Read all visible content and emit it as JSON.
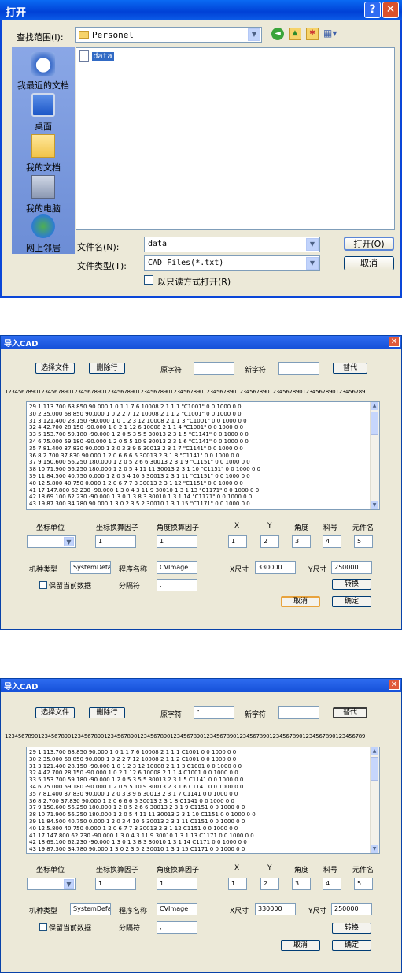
{
  "open_dialog": {
    "title": "打开",
    "look_in_label": "查找范围(I):",
    "look_in_value": "Personel",
    "files": [
      "data"
    ],
    "places": [
      "我最近的文档",
      "桌面",
      "我的文档",
      "我的电脑",
      "网上邻居"
    ],
    "filename_label": "文件名(N):",
    "filename_value": "data",
    "filetype_label": "文件类型(T):",
    "filetype_value": "CAD Files(*.txt)",
    "readonly_label": "以只读方式打开(R)",
    "open_button": "打开(O)",
    "cancel_button": "取消"
  },
  "import_dialogs": [
    {
      "title": "导入CAD",
      "select_file_button": "选择文件",
      "delete_row_button": "删除行",
      "orig_char_label": "原字符",
      "orig_char_value": "",
      "new_char_label": "新字符",
      "new_char_value": "",
      "replace_button": "替代",
      "ruler": "1234567890123456789012345678901234567890123456789012345678901234567890123456789012345678901234567890123456789",
      "rows": [
        "29 1 113.700 68.850 90.000 1 0 1 1 7 6 10008 2 1 1 1 \"C1001\" 0 0 1000 0 0",
        "30 2 35.000 68.850 90.000 1 0 2 2 7 12 10008 2 1 1 2 \"C1001\" 0 0 1000 0 0",
        "31 3 121.400 28.150 -90.000 1 0 1 2 3 12 10008 2 1 1 3 \"C1001\" 0 0 1000 0 0",
        "32 4 42.700 28.150 -90.000 1 0 2 1 12 6 10008 2 1 1 4 \"C1001\" 0 0 1000 0 0",
        "33 5 153.700 59.180 -90.000 1 2 0 5 3 5 5 30013 2 3 1 5 \"C1141\" 0 0 1000 0 0",
        "34 6 75.000 59.180 -90.000 1 2 0 5 5 10 9 30013 2 3 1 6 \"C1141\" 0 0 1000 0 0",
        "35 7 81.400 37.830 90.000 1 2 0 3 3 9 6 30013 2 3 1 7 \"C1141\" 0 0 1000 0 0",
        "36 8 2.700 37.830 90.000 1 2 0 6 6 6 5 30013 2 3 1 8 \"C1141\" 0 0 1000 0 0",
        "37 9 150.600 56.250 180.000 1 2 0 5 2 6 6 30013 2 3 1 9 \"C1151\" 0 0 1000 0 0",
        "38 10 71.900 56.250 180.000 1 2 0 5 4 11 11 30013 2 3 1 10 \"C1151\" 0 0 1000 0 0",
        "39 11 84.500 40.750 0.000 1 2 0 3 4 10 5 30013 2 3 1 11 \"C1151\" 0 0 1000 0 0",
        "40 12 5.800 40.750 0.000 1 2 0 6 7 7 3 30013 2 3 1 12 \"C1151\" 0 0 1000 0 0",
        "41 17 147.800 62.230 -90.000 1 3 0 4 3 11 9 30010 1 3 1 13 \"C1171\" 0 0 1000 0 0",
        "42 18 69.100 62.230 -90.000 1 3 0 1 3 8 3 30010 1 3 1 14 \"C1171\" 0 0 1000 0 0",
        "43 19 87.300 34.780 90.000 1 3 0 2 3 5 2 30010 1 3 1 15 \"C1171\" 0 0 1000 0 0"
      ],
      "coord_unit_label": "坐标单位",
      "coord_unit_value": "",
      "coord_scale_label": "坐标换算因子",
      "coord_scale_value": "1",
      "angle_scale_label": "角度换算因子",
      "angle_scale_value": "1",
      "x_label": "X",
      "x_value": "1",
      "y_label": "Y",
      "y_value": "2",
      "angle_label": "角度",
      "angle_value": "3",
      "part_label": "料号",
      "part_value": "4",
      "comp_label": "元件名",
      "comp_value": "5",
      "machine_type_label": "机种类型",
      "machine_type_value": "SystemDefault",
      "program_label": "程序名称",
      "program_value": "CVImage",
      "xsize_label": "X尺寸",
      "xsize_value": "330000",
      "ysize_label": "Y尺寸",
      "ysize_value": "250000",
      "keep_label": "保留当前数据",
      "sep_label": "分隔符",
      "sep_value": ",",
      "convert_button": "转换",
      "cancel_button": "取消",
      "ok_button": "确定"
    },
    {
      "title": "导入CAD",
      "select_file_button": "选择文件",
      "delete_row_button": "删除行",
      "orig_char_label": "原字符",
      "orig_char_value": "\"",
      "new_char_label": "新字符",
      "new_char_value": "",
      "replace_button": "替代",
      "ruler": "1234567890123456789012345678901234567890123456789012345678901234567890123456789012345678901234567890123456789",
      "rows": [
        "29 1 113.700 68.850 90.000 1 0 1 1 7 6 10008 2 1 1 1 C1001 0 0 1000 0 0",
        "30 2 35.000 68.850 90.000 1 0 2 2 7 12 10008 2 1 1 2 C1001 0 0 1000 0 0",
        "31 3 121.400 28.150 -90.000 1 0 1 2 3 12 10008 2 1 1 3 C1001 0 0 1000 0 0",
        "32 4 42.700 28.150 -90.000 1 0 2 1 12 6 10008 2 1 1 4 C1001 0 0 1000 0 0",
        "33 5 153.700 59.180 -90.000 1 2 0 5 3 5 5 30013 2 3 1 5 C1141 0 0 1000 0 0",
        "34 6 75.000 59.180 -90.000 1 2 0 5 5 10 9 30013 2 3 1 6 C1141 0 0 1000 0 0",
        "35 7 81.400 37.830 90.000 1 2 0 3 3 9 6 30013 2 3 1 7 C1141 0 0 1000 0 0",
        "36 8 2.700 37.830 90.000 1 2 0 6 6 6 5 30013 2 3 1 8 C1141 0 0 1000 0 0",
        "37 9 150.600 56.250 180.000 1 2 0 5 2 6 6 30013 2 3 1 9 C1151 0 0 1000 0 0",
        "38 10 71.900 56.250 180.000 1 2 0 5 4 11 11 30013 2 3 1 10 C1151 0 0 1000 0 0",
        "39 11 84.500 40.750 0.000 1 2 0 3 4 10 5 30013 2 3 1 11 C1151 0 0 1000 0 0",
        "40 12 5.800 40.750 0.000 1 2 0 6 7 7 3 30013 2 3 1 12 C1151 0 0 1000 0 0",
        "41 17 147.800 62.230 -90.000 1 3 0 4 3 11 9 30010 1 3 1 13 C1171 0 0 1000 0 0",
        "42 18 69.100 62.230 -90.000 1 3 0 1 3 8 3 30010 1 3 1 14 C1171 0 0 1000 0 0",
        "43 19 87.300 34.780 90.000 1 3 0 2 3 5 2 30010 1 3 1 15 C1171 0 0 1000 0 0"
      ],
      "coord_unit_label": "坐标单位",
      "coord_unit_value": "",
      "coord_scale_label": "坐标换算因子",
      "coord_scale_value": "1",
      "angle_scale_label": "角度换算因子",
      "angle_scale_value": "1",
      "x_label": "X",
      "x_value": "1",
      "y_label": "Y",
      "y_value": "2",
      "angle_label": "角度",
      "angle_value": "3",
      "part_label": "料号",
      "part_value": "4",
      "comp_label": "元件名",
      "comp_value": "5",
      "machine_type_label": "机种类型",
      "machine_type_value": "SystemDefault",
      "program_label": "程序名称",
      "program_value": "CVImage",
      "xsize_label": "X尺寸",
      "xsize_value": "330000",
      "ysize_label": "Y尺寸",
      "ysize_value": "250000",
      "keep_label": "保留当前数据",
      "sep_label": "分隔符",
      "sep_value": ",",
      "convert_button": "转换",
      "cancel_button": "取消",
      "ok_button": "确定"
    }
  ]
}
